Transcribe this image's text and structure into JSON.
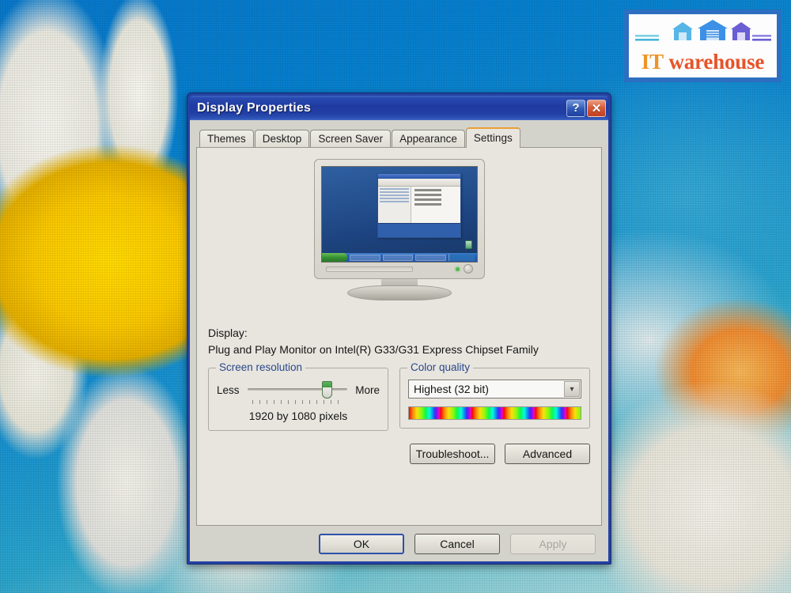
{
  "watermark": {
    "brand_top": "IT",
    "brand_bottom": "warehouse",
    "colors": {
      "it": "#e8952e",
      "warehouse": "#e2542c",
      "frame": "#2f6fbd"
    },
    "house_colors": [
      "#5bb4e5",
      "#3f8fe0",
      "#6a5fd0"
    ]
  },
  "dialog": {
    "title": "Display Properties",
    "titlebar_color": "#1a39a8",
    "help_button": "?",
    "close_button": "✕",
    "tabs": [
      {
        "label": "Themes",
        "active": false
      },
      {
        "label": "Desktop",
        "active": false
      },
      {
        "label": "Screen Saver",
        "active": false
      },
      {
        "label": "Appearance",
        "active": false
      },
      {
        "label": "Settings",
        "active": true
      }
    ],
    "settings": {
      "display_label": "Display:",
      "display_value": "Plug and Play Monitor on Intel(R) G33/G31 Express Chipset Family",
      "screen_resolution": {
        "group_title": "Screen resolution",
        "less_label": "Less",
        "more_label": "More",
        "value_text": "1920 by 1080 pixels",
        "slider_position_percent": 74,
        "thumb_color": "#3d9b3d"
      },
      "color_quality": {
        "group_title": "Color quality",
        "selected_option": "Highest (32 bit)",
        "dropdown_arrow": "▾"
      },
      "secondary_buttons": [
        {
          "label": "Troubleshoot...",
          "disabled": false
        },
        {
          "label": "Advanced",
          "disabled": false
        }
      ]
    },
    "footer_buttons": [
      {
        "label": "OK",
        "default": true,
        "disabled": false
      },
      {
        "label": "Cancel",
        "default": false,
        "disabled": false
      },
      {
        "label": "Apply",
        "default": false,
        "disabled": true
      }
    ]
  },
  "desktop": {
    "wallpaper_description": "daisy flower photograph",
    "accent_blue": "#0c76c4",
    "petal_white": "#f1f0e8",
    "center_yellow": "#f6c707"
  }
}
